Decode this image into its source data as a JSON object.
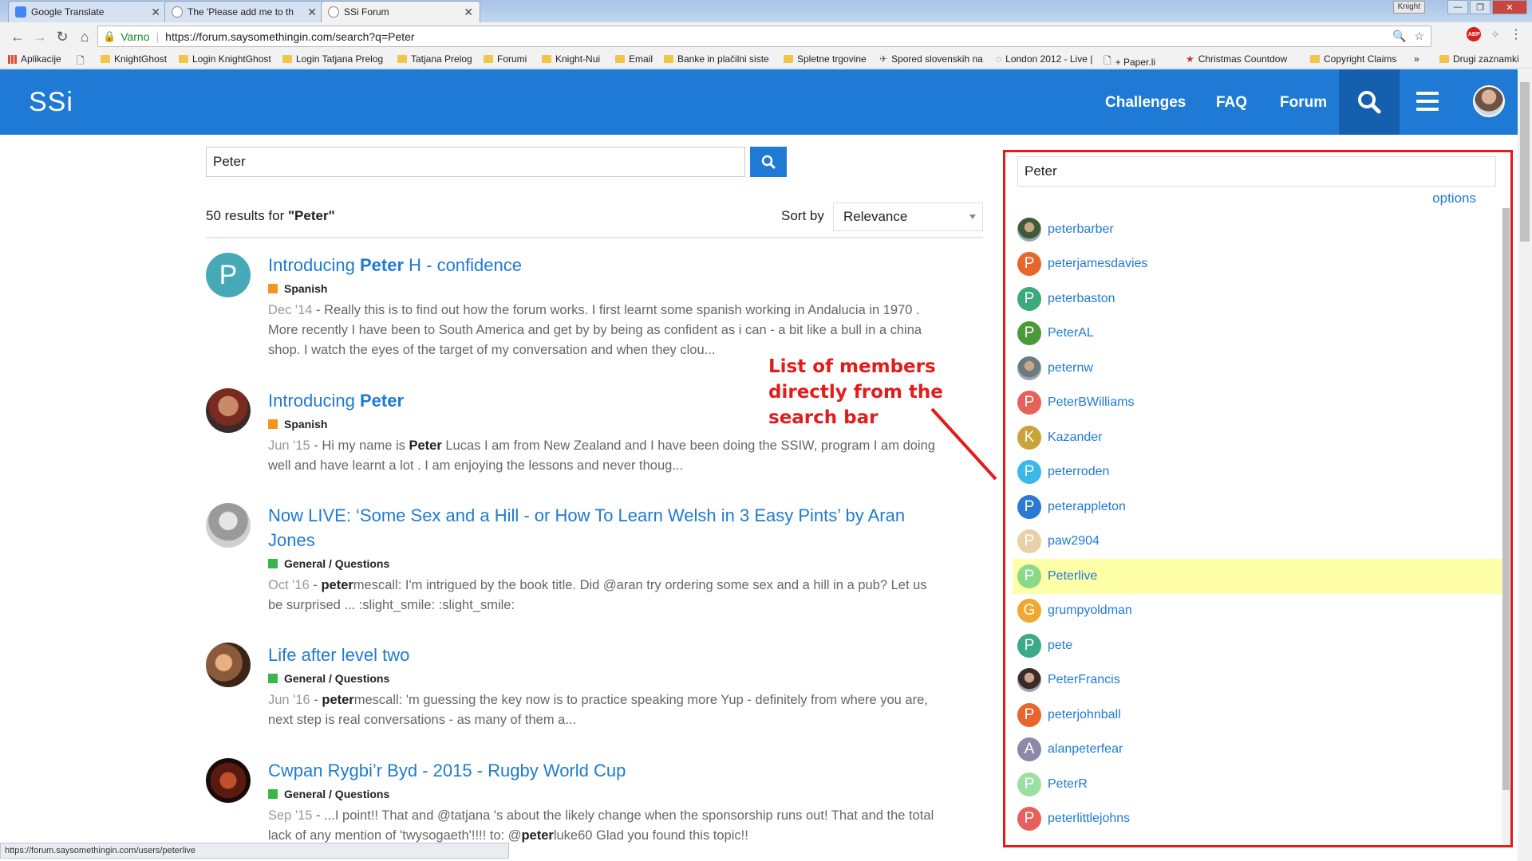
{
  "browser": {
    "tabs": [
      {
        "title": "Google Translate",
        "color": "#4285f4"
      },
      {
        "title": "The 'Please add me to th",
        "color": "#888888"
      },
      {
        "title": "SSi Forum",
        "color": "#888888"
      }
    ],
    "profile": "Knight",
    "secure_label": "Varno",
    "url": "https://forum.saysomethingin.com/search?q=Peter",
    "bookmarks": [
      "Aplikacije",
      "KnightGhost",
      "Login KnightGhost",
      "Login Tatjana Prelog",
      "Tatjana Prelog",
      "Forumi",
      "Knight-Nui",
      "Email",
      "Banke in plačilni siste",
      "Spletne trgovine",
      "Spored slovenskih na",
      "London 2012 - Live |",
      "+ Paper.li",
      "Christmas Countdow",
      "Copyright Claims",
      "»",
      "Drugi zaznamki"
    ],
    "status_url": "https://forum.saysomethingin.com/users/peterlive",
    "abp_label": "ABP"
  },
  "header": {
    "logo": "SSi",
    "nav": [
      "Challenges",
      "FAQ",
      "Forum"
    ],
    "brand_color": "#1e7ad4"
  },
  "search": {
    "query": "Peter",
    "count_prefix": "50 results for ",
    "count_query": "\"Peter\"",
    "sort_label": "Sort by",
    "sort_value": "Relevance"
  },
  "results": [
    {
      "title_pre": "Introducing ",
      "title_bold": "Peter",
      "title_post": " H - confidence",
      "category": "Spanish",
      "category_color": "#f7941d",
      "date": "Dec '14",
      "blurb_pre": " - Really this is to find out how the forum works. I first learnt some spanish working in Andalucia in 1970 . More recently I have been to South America and get by by being as confident as i can - a bit like a bull in a china shop. I watch the eyes of the target of my conversation and when they clou...",
      "blurb_bold": "",
      "blurb_post": "",
      "avatar_letter": "P",
      "avatar_color": "#45a9b7"
    },
    {
      "title_pre": "Introducing ",
      "title_bold": "Peter",
      "title_post": "",
      "category": "Spanish",
      "category_color": "#f7941d",
      "date": "Jun '15",
      "blurb_pre": " - Hi my name is ",
      "blurb_bold": "Peter",
      "blurb_post": " Lucas I am from New Zealand and I have been doing the SSIW, program I am doing well and have learnt a lot . I am enjoying the lessons and never thoug...",
      "avatar_letter": "",
      "avatar_color": "#7a3b2a"
    },
    {
      "title_pre": "Now LIVE: ‘Some Sex and a Hill - or How To Learn Welsh in 3 Easy Pints’ by Aran Jones",
      "title_bold": "",
      "title_post": "",
      "category": "General / Questions",
      "category_color": "#3ab54a",
      "date": "Oct '16",
      "blurb_pre": " - ",
      "blurb_bold": "peter",
      "blurb_post": "mescall: I'm intrigued by the book title. Did @aran try ordering some sex and a hill in a pub? Let us be surprised ... :slight_smile: :slight_smile:",
      "avatar_letter": "",
      "avatar_color": "#9a9a9a"
    },
    {
      "title_pre": "Life after level two",
      "title_bold": "",
      "title_post": "",
      "category": "General / Questions",
      "category_color": "#3ab54a",
      "date": "Jun '16",
      "blurb_pre": " - ",
      "blurb_bold": "peter",
      "blurb_post": "mescall: 'm guessing the key now is to practice speaking more Yup - definitely from where you are, next step is real conversations - as many of them a...",
      "avatar_letter": "",
      "avatar_color": "#8a5a3a"
    },
    {
      "title_pre": "Cwpan Rygbi’r Byd - 2015 - Rugby World Cup",
      "title_bold": "",
      "title_post": "",
      "category": "General / Questions",
      "category_color": "#3ab54a",
      "date": "Sep '15",
      "blurb_pre": " - ...I point!! That and @tatjana 's about the likely change when the sponsorship runs out! That and the total lack of any mention of 'twysogaeth'!!!! to: @",
      "blurb_bold": "peter",
      "blurb_post": "luke60 Glad you found this topic!!",
      "avatar_letter": "",
      "avatar_color": "#5a1a10"
    }
  ],
  "annotation": [
    "List of members",
    "directly from the",
    "search bar"
  ],
  "panel": {
    "query": "Peter",
    "options_label": "options",
    "members": [
      {
        "name": "peterbarber",
        "letter": "",
        "color": "#3d5a3a"
      },
      {
        "name": "peterjamesdavies",
        "letter": "P",
        "color": "#e8652c"
      },
      {
        "name": "peterbaston",
        "letter": "P",
        "color": "#3aaa7a"
      },
      {
        "name": "PeterAL",
        "letter": "P",
        "color": "#4a9a3a"
      },
      {
        "name": "peternw",
        "letter": "",
        "color": "#6b7a80"
      },
      {
        "name": "PeterBWilliams",
        "letter": "P",
        "color": "#e8605a"
      },
      {
        "name": "Kazander",
        "letter": "K",
        "color": "#c9a23a"
      },
      {
        "name": "peterroden",
        "letter": "P",
        "color": "#3ab8e8"
      },
      {
        "name": "peterappleton",
        "letter": "P",
        "color": "#2a7ad4"
      },
      {
        "name": "paw2904",
        "letter": "P",
        "color": "#e8d0a8"
      },
      {
        "name": "Peterlive",
        "letter": "P",
        "color": "#8ad88a",
        "highlight": true
      },
      {
        "name": "grumpyoldman",
        "letter": "G",
        "color": "#f0a830"
      },
      {
        "name": "pete",
        "letter": "P",
        "color": "#3aaa8a"
      },
      {
        "name": "PeterFrancis",
        "letter": "",
        "color": "#3a2a2a"
      },
      {
        "name": "peterjohnball",
        "letter": "P",
        "color": "#e8652c"
      },
      {
        "name": "alanpeterfear",
        "letter": "A",
        "color": "#8a8aa8"
      },
      {
        "name": "PeterR",
        "letter": "P",
        "color": "#9ae0a0"
      },
      {
        "name": "peterlittlejohns",
        "letter": "P",
        "color": "#e8605a"
      }
    ]
  }
}
